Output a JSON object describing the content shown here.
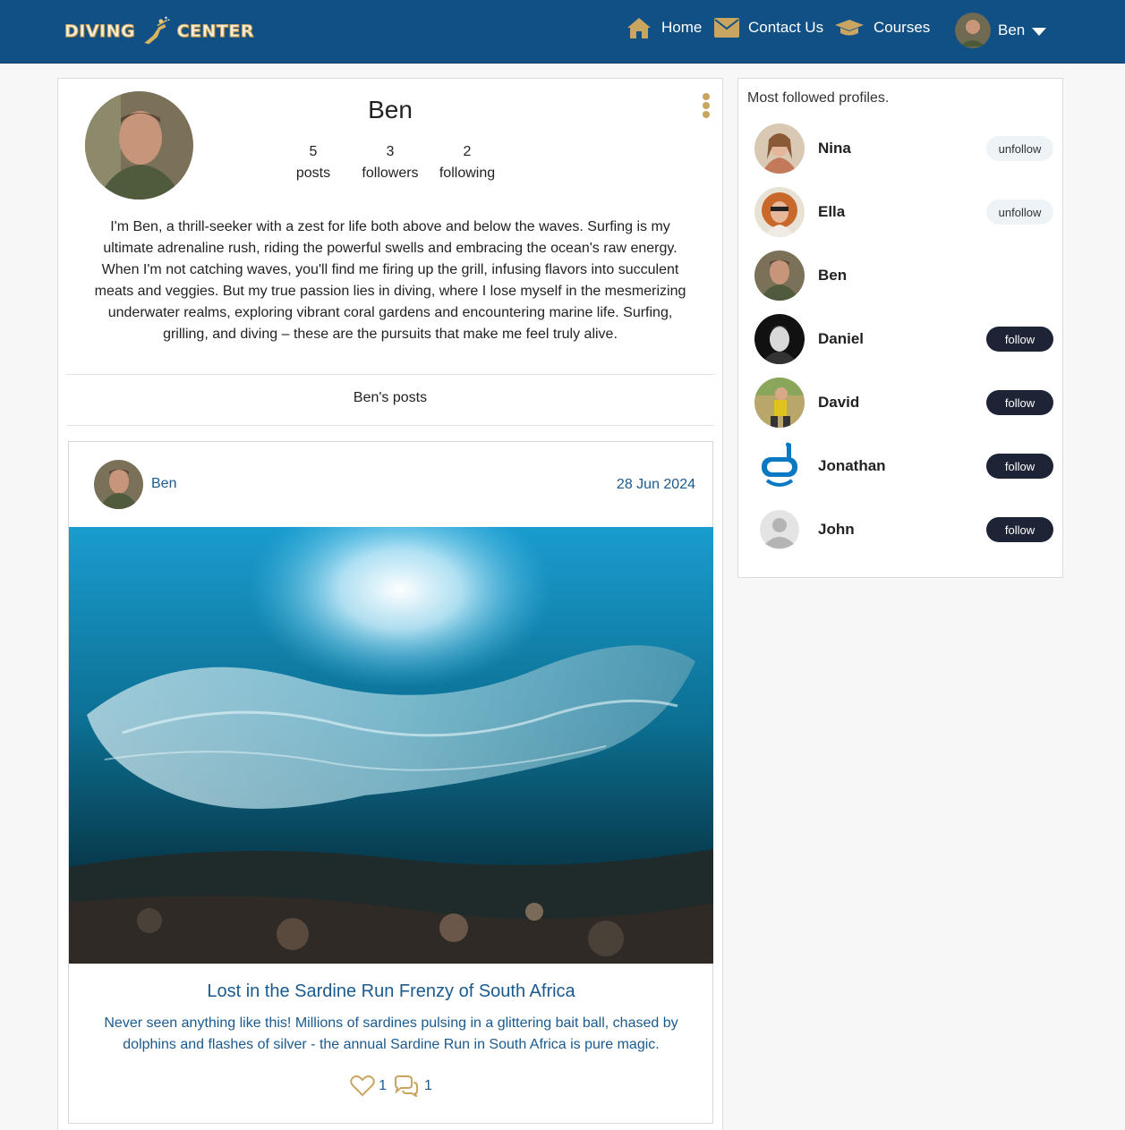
{
  "navbar": {
    "logo_left": "DIVING",
    "logo_right": "CENTER",
    "home_label": "Home",
    "contact_label": "Contact Us",
    "courses_label": "Courses",
    "user_name": "Ben"
  },
  "profile": {
    "name": "Ben",
    "posts_count": "5",
    "posts_label": "posts",
    "followers_count": "3",
    "followers_label": "followers",
    "following_count": "2",
    "following_label": "following",
    "bio": "I'm Ben, a thrill-seeker with a zest for life both above and below the waves. Surfing is my ultimate adrenaline rush, riding the powerful swells and embracing the ocean's raw energy. When I'm not catching waves, you'll find me firing up the grill, infusing flavors into succulent meats and veggies. But my true passion lies in diving, where I lose myself in the mesmerizing underwater realms, exploring vibrant coral gardens and encountering marine life. Surfing, grilling, and diving – these are the pursuits that make me feel truly alive.",
    "posts_heading": "Ben's posts"
  },
  "post": {
    "author": "Ben",
    "date": "28 Jun 2024",
    "title": "Lost in the Sardine Run Frenzy of South Africa",
    "text": "Never seen anything like this! Millions of sardines pulsing in a glittering bait ball, chased by dolphins and flashes of silver - the annual Sardine Run in South Africa is pure magic.",
    "likes": "1",
    "comments": "1"
  },
  "sidebar": {
    "title": "Most followed profiles.",
    "profiles": [
      {
        "name": "Nina",
        "action": "unfollow"
      },
      {
        "name": "Ella",
        "action": "unfollow"
      },
      {
        "name": "Ben",
        "action": ""
      },
      {
        "name": "Daniel",
        "action": "follow"
      },
      {
        "name": "David",
        "action": "follow"
      },
      {
        "name": "Jonathan",
        "action": "follow"
      },
      {
        "name": "John",
        "action": "follow"
      }
    ]
  },
  "colors": {
    "navbar": "#115084",
    "accent_gold": "#c8a661",
    "link_blue": "#1a5a8e",
    "follow_button": "#1d2436",
    "unfollow_button": "#eef3f8"
  },
  "icons": [
    "home-icon",
    "envelope-icon",
    "graduation-cap-icon",
    "caret-down-icon",
    "more-vertical-icon",
    "heart-icon",
    "comments-icon",
    "snorkel-mask-icon",
    "default-user-icon"
  ]
}
